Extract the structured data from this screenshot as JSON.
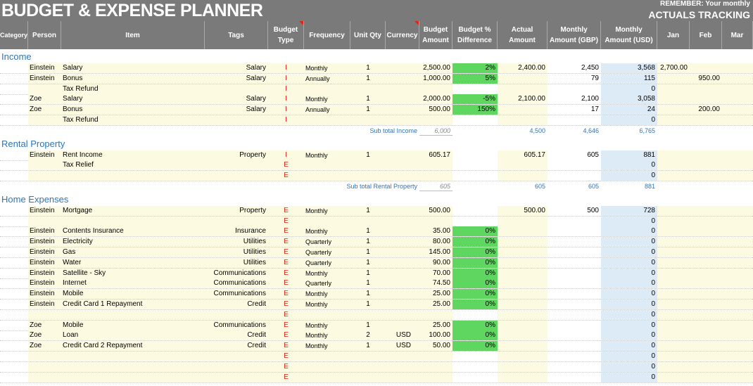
{
  "title": "BUDGET & EXPENSE PLANNER",
  "remember": "REMEMBER: Your monthly",
  "actuals_tracking": "ACTUALS TRACKING",
  "colors": {
    "header_bg": "#7a7a7a",
    "yellow": "#fcfbe2",
    "blue": "#ddebf7",
    "green": "#5fd65f",
    "section": "#2e75b6",
    "type_red": "#e0231b"
  },
  "headers": [
    {
      "label": "Category"
    },
    {
      "label": "Person"
    },
    {
      "label": "Item"
    },
    {
      "label": "Tags"
    },
    {
      "label": "Budget\nType"
    },
    {
      "label": "Frequency"
    },
    {
      "label": "Unit Qty"
    },
    {
      "label": "Currency"
    },
    {
      "label": "Budget\nAmount"
    },
    {
      "label": "Budget %\nDifference"
    },
    {
      "label": "Actual\nAmount"
    },
    {
      "label": "Monthly\nAmount  (GBP)"
    },
    {
      "label": "Monthly\nAmount  (USD)"
    },
    {
      "label": "Jan"
    },
    {
      "label": "Feb"
    },
    {
      "label": "Mar"
    }
  ],
  "sections": [
    {
      "name": "Income",
      "rows": [
        {
          "person": "Einstein",
          "item": "Salary",
          "tags": "Salary",
          "type": "I",
          "freq": "Monthly",
          "qty": "1",
          "cur": "",
          "budget": "2,500.00",
          "pct": "2%",
          "actual": "2,400.00",
          "gbp": "2,450",
          "usd": "3,568",
          "jan": "2,700.00",
          "feb": "",
          "mar": ""
        },
        {
          "person": "Einstein",
          "item": "Bonus",
          "tags": "Salary",
          "type": "I",
          "freq": "Annually",
          "qty": "1",
          "cur": "",
          "budget": "1,000.00",
          "pct": "5%",
          "actual": "",
          "gbp": "79",
          "usd": "115",
          "jan": "",
          "feb": "950.00",
          "mar": ""
        },
        {
          "person": "",
          "item": "Tax Refund",
          "tags": "",
          "type": "I",
          "freq": "",
          "qty": "",
          "cur": "",
          "budget": "",
          "pct": "",
          "actual": "",
          "gbp": "",
          "usd": "0",
          "jan": "",
          "feb": "",
          "mar": ""
        },
        {
          "person": "Zoe",
          "item": "Salary",
          "tags": "Salary",
          "type": "I",
          "freq": "Monthly",
          "qty": "1",
          "cur": "",
          "budget": "2,000.00",
          "pct": "-5%",
          "actual": "2,100.00",
          "gbp": "2,100",
          "usd": "3,058",
          "jan": "",
          "feb": "",
          "mar": ""
        },
        {
          "person": "Zoe",
          "item": "Bonus",
          "tags": "Salary",
          "type": "I",
          "freq": "Annually",
          "qty": "1",
          "cur": "",
          "budget": "500.00",
          "pct": "150%",
          "actual": "",
          "gbp": "17",
          "usd": "24",
          "jan": "",
          "feb": "200.00",
          "mar": ""
        },
        {
          "person": "",
          "item": "Tax Refund",
          "tags": "",
          "type": "I",
          "freq": "",
          "qty": "",
          "cur": "",
          "budget": "",
          "pct": "",
          "actual": "",
          "gbp": "",
          "usd": "0",
          "jan": "",
          "feb": "",
          "mar": ""
        }
      ],
      "subtotal": {
        "label": "Sub total Income",
        "budget": "6,000",
        "actual": "4,500",
        "gbp": "4,646",
        "usd": "6,765"
      }
    },
    {
      "name": "Rental Property",
      "rows": [
        {
          "person": "Einstein",
          "item": "Rent Income",
          "tags": "Property",
          "type": "I",
          "freq": "Monthly",
          "qty": "1",
          "cur": "",
          "budget": "605.17",
          "pct": "",
          "actual": "605.17",
          "gbp": "605",
          "usd": "881",
          "jan": "",
          "feb": "",
          "mar": ""
        },
        {
          "person": "",
          "item": "Tax Relief",
          "tags": "",
          "type": "E",
          "freq": "",
          "qty": "",
          "cur": "",
          "budget": "",
          "pct": "",
          "actual": "",
          "gbp": "",
          "usd": "0",
          "jan": "",
          "feb": "",
          "mar": ""
        },
        {
          "person": "",
          "item": "",
          "tags": "",
          "type": "E",
          "freq": "",
          "qty": "",
          "cur": "",
          "budget": "",
          "pct": "",
          "actual": "",
          "gbp": "",
          "usd": "0",
          "jan": "",
          "feb": "",
          "mar": ""
        }
      ],
      "subtotal": {
        "label": "Sub total Rental Property",
        "budget": "605",
        "actual": "605",
        "gbp": "605",
        "usd": "881"
      }
    },
    {
      "name": "Home Expenses",
      "rows": [
        {
          "person": "Einstein",
          "item": "Mortgage",
          "tags": "Property",
          "type": "E",
          "freq": "Monthly",
          "qty": "1",
          "cur": "",
          "budget": "500.00",
          "pct": "",
          "actual": "500.00",
          "gbp": "500",
          "usd": "728",
          "jan": "",
          "feb": "",
          "mar": ""
        },
        {
          "person": "",
          "item": "",
          "tags": "",
          "type": "E",
          "freq": "",
          "qty": "",
          "cur": "",
          "budget": "",
          "pct": "",
          "actual": "",
          "gbp": "",
          "usd": "0",
          "jan": "",
          "feb": "",
          "mar": ""
        },
        {
          "person": "Einstein",
          "item": "Contents Insurance",
          "tags": "Insurance",
          "type": "E",
          "freq": "Monthly",
          "qty": "1",
          "cur": "",
          "budget": "35.00",
          "pct": "0%",
          "actual": "",
          "gbp": "",
          "usd": "0",
          "jan": "",
          "feb": "",
          "mar": ""
        },
        {
          "person": "Einstein",
          "item": "Electricity",
          "tags": "Utilities",
          "type": "E",
          "freq": "Quarterly",
          "qty": "1",
          "cur": "",
          "budget": "80.00",
          "pct": "0%",
          "actual": "",
          "gbp": "",
          "usd": "0",
          "jan": "",
          "feb": "",
          "mar": ""
        },
        {
          "person": "Einstein",
          "item": "Gas",
          "tags": "Utilities",
          "type": "E",
          "freq": "Quarterly",
          "qty": "1",
          "cur": "",
          "budget": "145.00",
          "pct": "0%",
          "actual": "",
          "gbp": "",
          "usd": "0",
          "jan": "",
          "feb": "",
          "mar": ""
        },
        {
          "person": "Einstein",
          "item": "Water",
          "tags": "Utilities",
          "type": "E",
          "freq": "Quarterly",
          "qty": "1",
          "cur": "",
          "budget": "90.00",
          "pct": "0%",
          "actual": "",
          "gbp": "",
          "usd": "0",
          "jan": "",
          "feb": "",
          "mar": ""
        },
        {
          "person": "Einstein",
          "item": "Satellite - Sky",
          "tags": "Communications",
          "type": "E",
          "freq": "Monthly",
          "qty": "1",
          "cur": "",
          "budget": "70.00",
          "pct": "0%",
          "actual": "",
          "gbp": "",
          "usd": "0",
          "jan": "",
          "feb": "",
          "mar": ""
        },
        {
          "person": "Einstein",
          "item": "Internet",
          "tags": "Communications",
          "type": "E",
          "freq": "Quarterly",
          "qty": "1",
          "cur": "",
          "budget": "74.50",
          "pct": "0%",
          "actual": "",
          "gbp": "",
          "usd": "0",
          "jan": "",
          "feb": "",
          "mar": ""
        },
        {
          "person": "Einstein",
          "item": "Mobile",
          "tags": "Communications",
          "type": "E",
          "freq": "Monthly",
          "qty": "1",
          "cur": "",
          "budget": "25.00",
          "pct": "0%",
          "actual": "",
          "gbp": "",
          "usd": "0",
          "jan": "",
          "feb": "",
          "mar": ""
        },
        {
          "person": "Einstein",
          "item": "Credit Card 1 Repayment",
          "tags": "Credit",
          "type": "E",
          "freq": "Monthly",
          "qty": "1",
          "cur": "",
          "budget": "25.00",
          "pct": "0%",
          "actual": "",
          "gbp": "",
          "usd": "0",
          "jan": "",
          "feb": "",
          "mar": ""
        },
        {
          "person": "",
          "item": "",
          "tags": "",
          "type": "E",
          "freq": "",
          "qty": "",
          "cur": "",
          "budget": "",
          "pct": "",
          "actual": "",
          "gbp": "",
          "usd": "0",
          "jan": "",
          "feb": "",
          "mar": ""
        },
        {
          "person": "Zoe",
          "item": "Mobile",
          "tags": "Communications",
          "type": "E",
          "freq": "Monthly",
          "qty": "1",
          "cur": "",
          "budget": "25.00",
          "pct": "0%",
          "actual": "",
          "gbp": "",
          "usd": "0",
          "jan": "",
          "feb": "",
          "mar": ""
        },
        {
          "person": "Zoe",
          "item": "Loan",
          "tags": "Credit",
          "type": "E",
          "freq": "Monthly",
          "qty": "2",
          "cur": "USD",
          "budget": "100.00",
          "pct": "0%",
          "actual": "",
          "gbp": "",
          "usd": "0",
          "jan": "",
          "feb": "",
          "mar": ""
        },
        {
          "person": "Zoe",
          "item": "Credit Card 2 Repayment",
          "tags": "Credit",
          "type": "E",
          "freq": "Monthly",
          "qty": "1",
          "cur": "USD",
          "budget": "50.00",
          "pct": "0%",
          "actual": "",
          "gbp": "",
          "usd": "0",
          "jan": "",
          "feb": "",
          "mar": ""
        },
        {
          "person": "",
          "item": "",
          "tags": "",
          "type": "E",
          "freq": "",
          "qty": "",
          "cur": "",
          "budget": "",
          "pct": "",
          "actual": "",
          "gbp": "",
          "usd": "0",
          "jan": "",
          "feb": "",
          "mar": ""
        },
        {
          "person": "",
          "item": "",
          "tags": "",
          "type": "E",
          "freq": "",
          "qty": "",
          "cur": "",
          "budget": "",
          "pct": "",
          "actual": "",
          "gbp": "",
          "usd": "0",
          "jan": "",
          "feb": "",
          "mar": ""
        },
        {
          "person": "",
          "item": "",
          "tags": "",
          "type": "E",
          "freq": "",
          "qty": "",
          "cur": "",
          "budget": "",
          "pct": "",
          "actual": "",
          "gbp": "",
          "usd": "0",
          "jan": "",
          "feb": "",
          "mar": ""
        }
      ]
    }
  ]
}
